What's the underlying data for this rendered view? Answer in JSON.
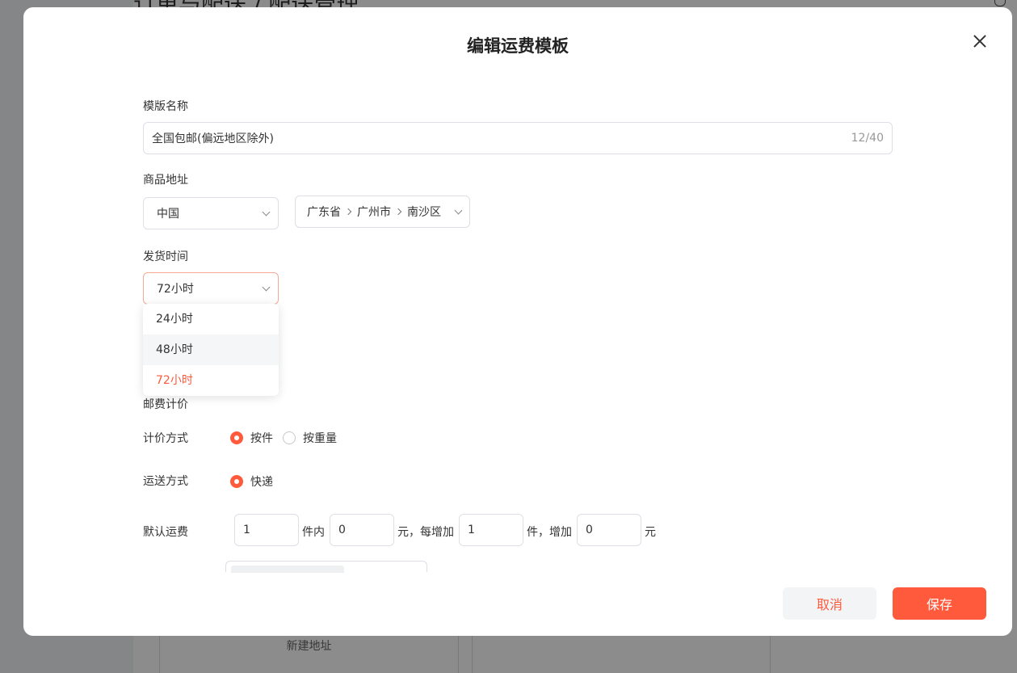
{
  "background": {
    "breadcrumb": "订单与配送 / 配送管理",
    "card_label": "新建地址"
  },
  "modal": {
    "title": "编辑运费模板",
    "template_name": {
      "label": "模版名称",
      "value": "全国包邮(偏远地区除外)",
      "counter": "12/40"
    },
    "goods_address": {
      "label": "商品地址",
      "country": "中国",
      "region_parts": [
        "广东省",
        "广州市",
        "南沙区"
      ]
    },
    "ship_time": {
      "label": "发货时间",
      "value": "72小时",
      "options": [
        "24小时",
        "48小时",
        "72小时"
      ],
      "hovered_index": 1,
      "selected_index": 2
    },
    "postage": {
      "section_label": "邮费计价",
      "pricing_label": "计价方式",
      "pricing_options": [
        "按件",
        "按重量"
      ],
      "pricing_selected": 0,
      "delivery_label": "运送方式",
      "delivery_option": "快递",
      "default_label": "默认运费",
      "first_qty": "1",
      "first_qty_suffix": "件内",
      "first_fee": "0",
      "first_fee_suffix": "元，每增加",
      "add_qty": "1",
      "add_qty_suffix": "件，增加",
      "add_fee": "0",
      "add_fee_suffix": "元"
    },
    "buttons": {
      "cancel": "取消",
      "save": "保存"
    }
  },
  "colors": {
    "accent": "#ff5a3c",
    "overlay": "rgba(0,0,0,0.45)"
  }
}
